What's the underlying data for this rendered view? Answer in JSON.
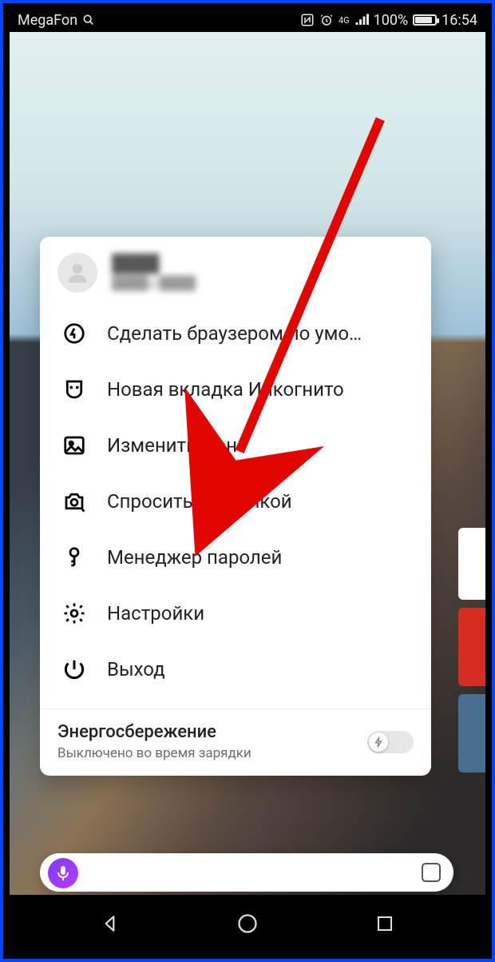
{
  "statusbar": {
    "carrier": "MegaFon",
    "battery_pct": "100%",
    "time": "16:54",
    "network": "4G"
  },
  "profile": {
    "name": "████",
    "email": "████@████"
  },
  "menu": {
    "default_browser": "Сделать браузером по умо…",
    "incognito": "Новая вкладка Инкогнито",
    "wallpaper": "Изменить фон",
    "image_search": "Спросить картинкой",
    "passwords": "Менеджер паролей",
    "settings": "Настройки",
    "exit": "Выход"
  },
  "energy": {
    "title": "Энергосбережение",
    "subtitle": "Выключено во время зарядки",
    "enabled": false
  }
}
